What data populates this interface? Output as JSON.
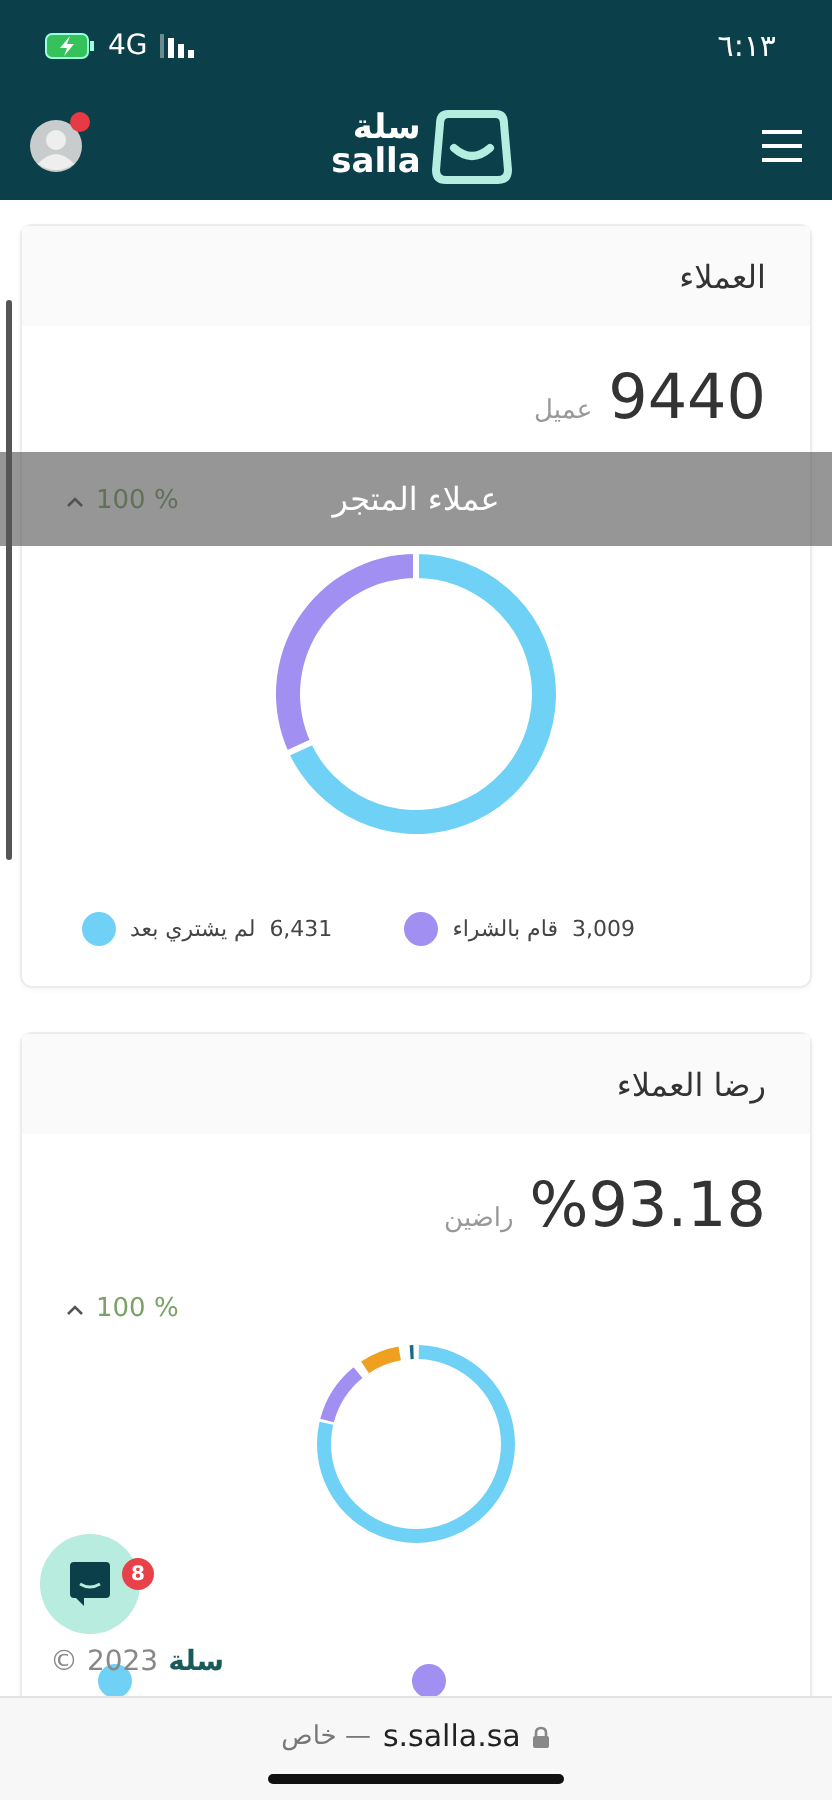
{
  "status_bar": {
    "network": "4G",
    "time": "٦:١٣"
  },
  "header": {
    "logo_arabic": "سلة",
    "logo_latin": "salla",
    "avatar_notification": true
  },
  "tooltip": {
    "text": "عملاء المتجر"
  },
  "cards": [
    {
      "kind": "chart",
      "title": "العملاء",
      "value": "9440",
      "unit": "عميل",
      "trend": "100 %",
      "legend": [
        {
          "label": "قام بالشراء",
          "count": "3,009",
          "color": "#a28ff2"
        },
        {
          "label": "لم يشتري بعد",
          "count": "6,431",
          "color": "#6fd1f6"
        }
      ],
      "chart_data": {
        "type": "donut",
        "values": [
          31.88,
          68.12
        ]
      }
    },
    {
      "kind": "picture",
      "title": "رضا العملاء",
      "value": "%93.18",
      "unit": "راضين",
      "trend": "100 %",
      "legend": [
        {
          "color": "#a28ff2"
        },
        {
          "color": "#6fd1f6"
        }
      ]
    }
  ],
  "chat": {
    "badge": "8"
  },
  "footer": {
    "brand": "سلة",
    "copyright": "© 2023"
  },
  "browser_bar": {
    "mode": "— خاص",
    "url": "s.salla.sa"
  }
}
